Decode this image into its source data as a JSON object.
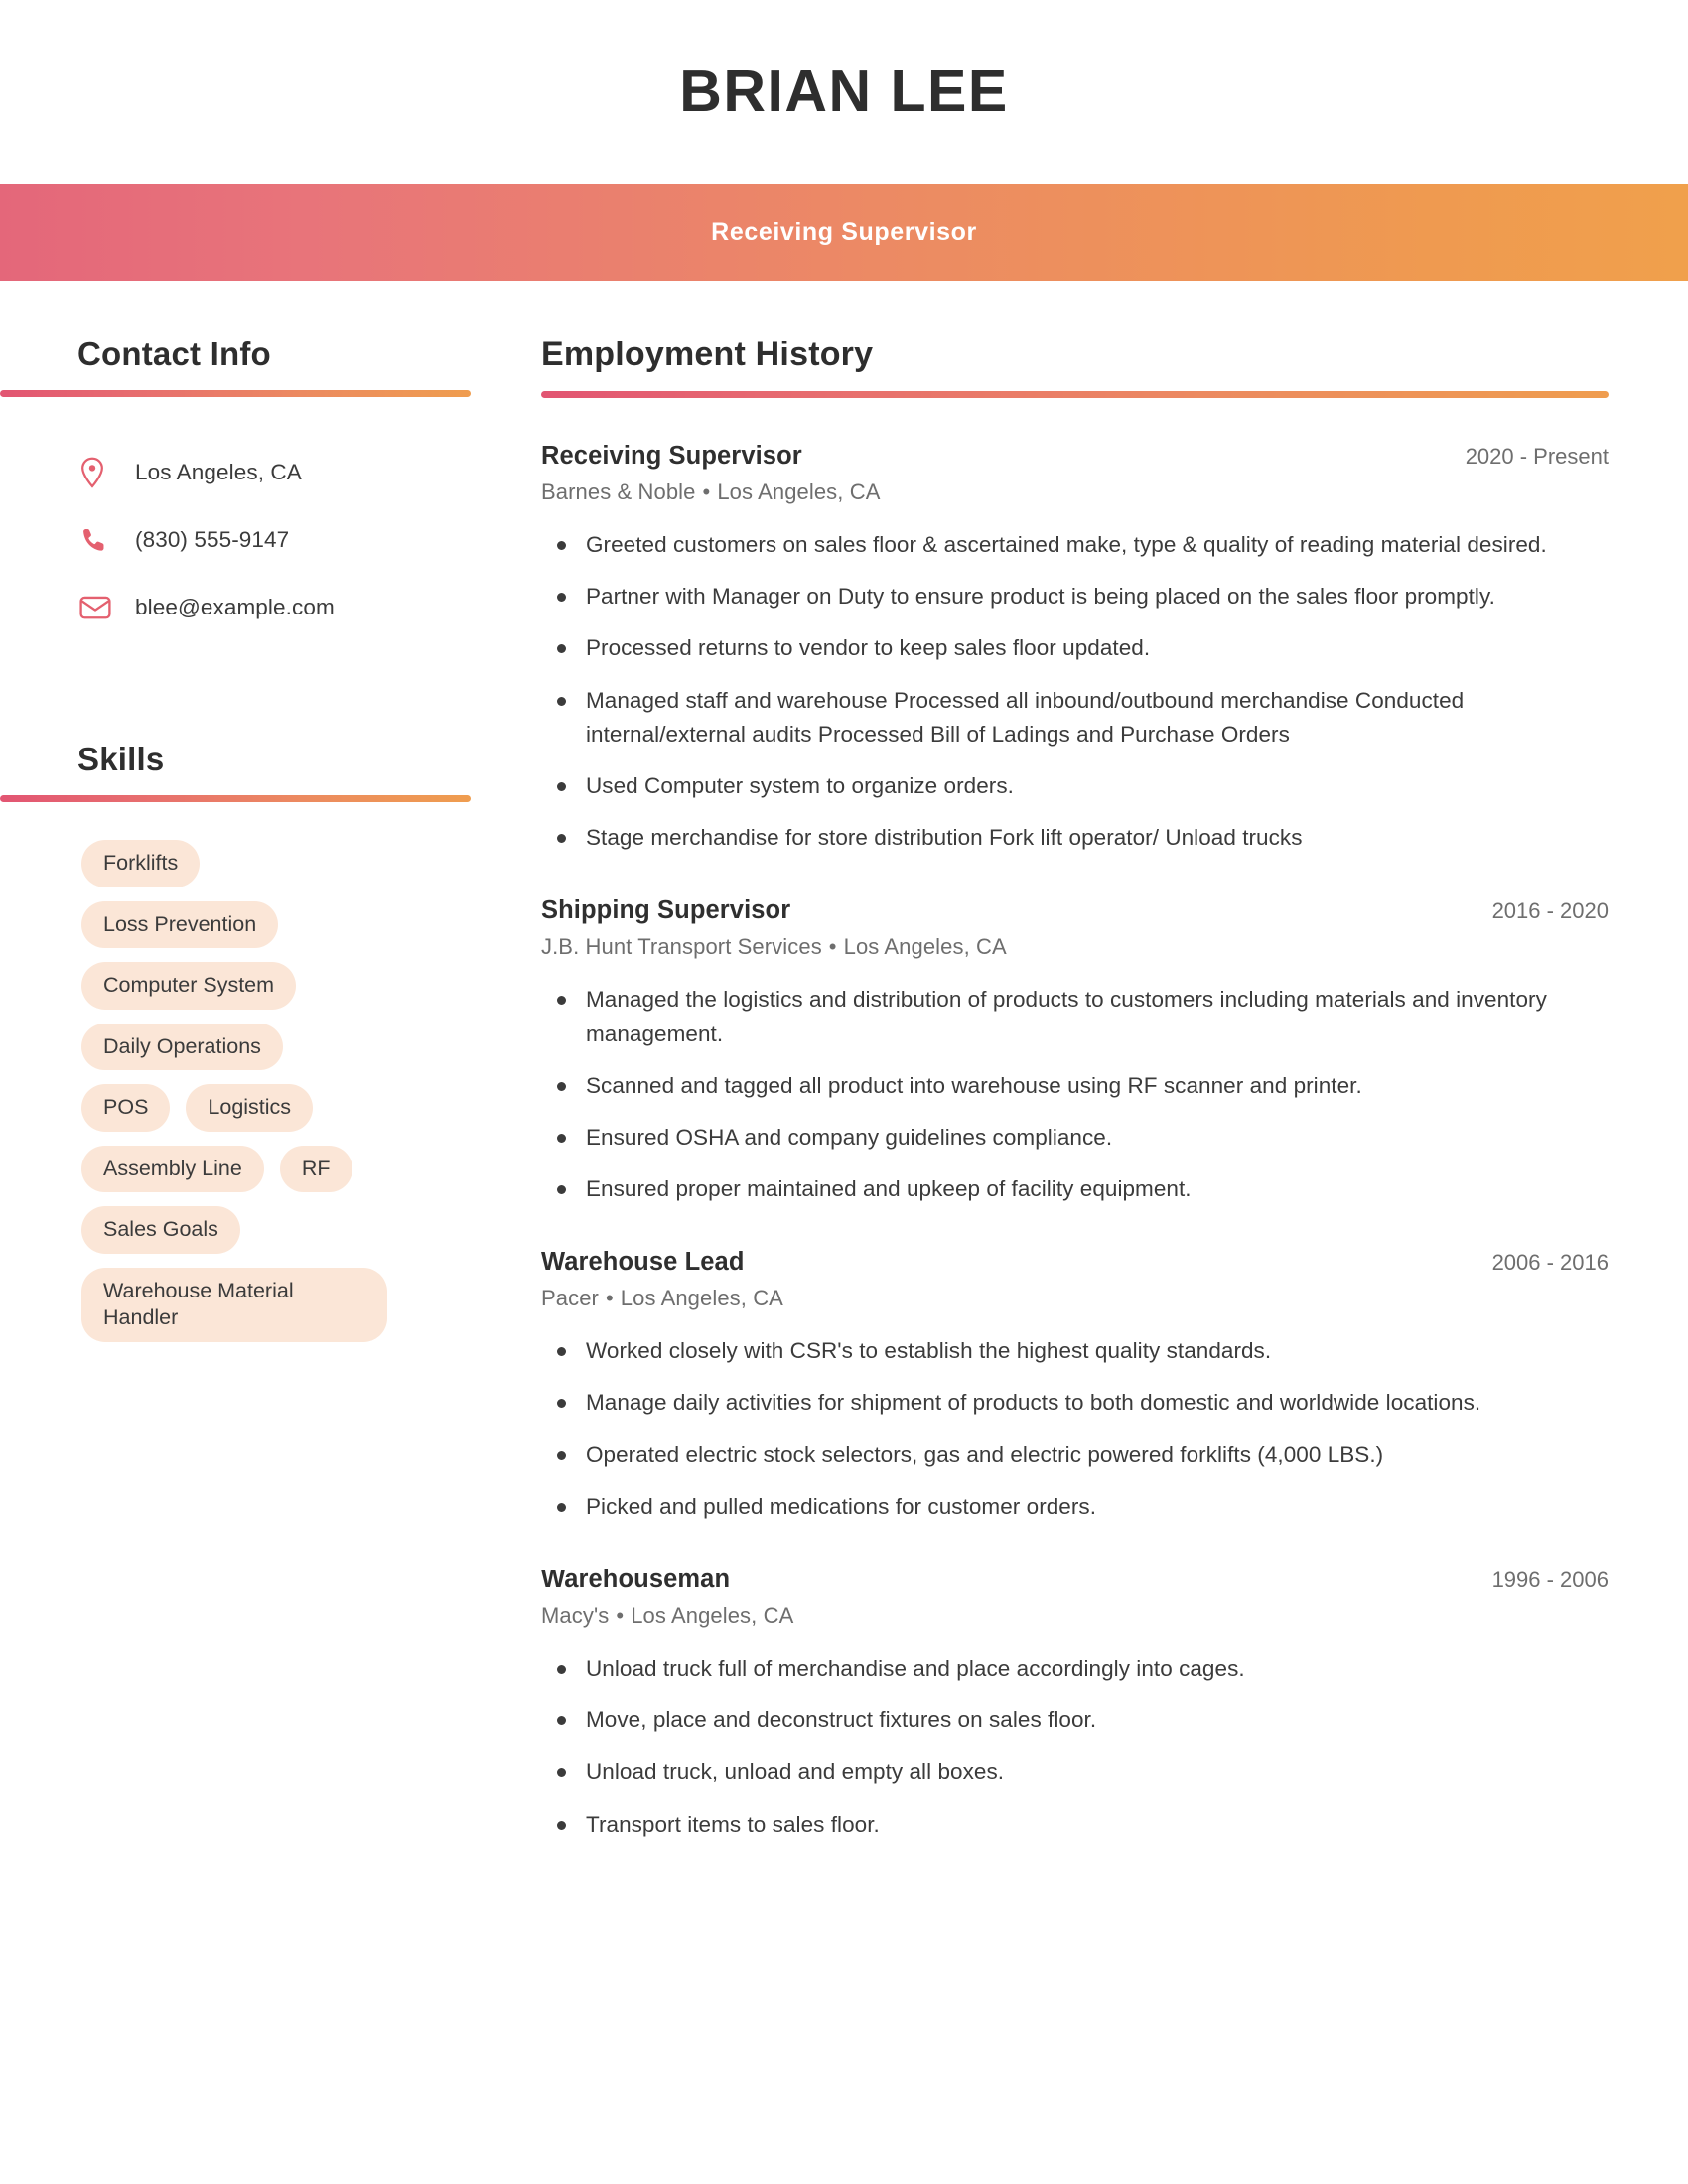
{
  "theme": {
    "gradient_start": "#e4677a",
    "gradient_end": "#f0a04c",
    "pill_background": "#fbe6d7",
    "text_dark": "#2e2e2e",
    "text_body": "#3b3b3b",
    "text_muted": "#6e6e6e"
  },
  "header": {
    "name": "BRIAN LEE",
    "role": "Receiving Supervisor"
  },
  "sidebar": {
    "contact": {
      "title": "Contact Info",
      "items": [
        {
          "icon": "location-pin-icon",
          "value": "Los Angeles, CA"
        },
        {
          "icon": "phone-icon",
          "value": "(830) 555-9147"
        },
        {
          "icon": "envelope-icon",
          "value": "blee@example.com"
        }
      ]
    },
    "skills": {
      "title": "Skills",
      "items": [
        "Forklifts",
        "Loss Prevention",
        "Computer System",
        "Daily Operations",
        "POS",
        "Logistics",
        "Assembly Line",
        "RF",
        "Sales Goals",
        "Warehouse Material Handler"
      ]
    }
  },
  "main": {
    "employment": {
      "title": "Employment History",
      "jobs": [
        {
          "title": "Receiving Supervisor",
          "dates": "2020 - Present",
          "company": "Barnes & Noble",
          "location": "Los Angeles, CA",
          "bullets": [
            "Greeted customers on sales floor & ascertained make, type & quality of reading material desired.",
            "Partner with Manager on Duty to ensure product is being placed on the sales floor promptly.",
            "Processed returns to vendor to keep sales floor updated.",
            "Managed staff and warehouse Processed all inbound/outbound merchandise Conducted internal/external audits Processed Bill of Ladings and Purchase Orders",
            "Used Computer system to organize orders.",
            "Stage merchandise for store distribution Fork lift operator/ Unload trucks"
          ]
        },
        {
          "title": "Shipping Supervisor",
          "dates": "2016 - 2020",
          "company": "J.B. Hunt Transport Services",
          "location": "Los Angeles, CA",
          "bullets": [
            "Managed the logistics and distribution of products to customers including materials and inventory management.",
            "Scanned and tagged all product into warehouse using RF scanner and printer.",
            "Ensured OSHA and company guidelines compliance.",
            "Ensured proper maintained and upkeep of facility equipment."
          ]
        },
        {
          "title": "Warehouse Lead",
          "dates": "2006 - 2016",
          "company": "Pacer",
          "location": "Los Angeles, CA",
          "bullets": [
            "Worked closely with CSR's to establish the highest quality standards.",
            "Manage daily activities for shipment of products to both domestic and worldwide locations.",
            "Operated electric stock selectors, gas and electric powered forklifts (4,000 LBS.)",
            "Picked and pulled medications for customer orders."
          ]
        },
        {
          "title": "Warehouseman",
          "dates": "1996 - 2006",
          "company": "Macy's",
          "location": "Los Angeles, CA",
          "bullets": [
            "Unload truck full of merchandise and place accordingly into cages.",
            "Move, place and deconstruct fixtures on sales floor.",
            "Unload truck, unload and empty all boxes.",
            "Transport items to sales floor."
          ]
        }
      ]
    }
  }
}
